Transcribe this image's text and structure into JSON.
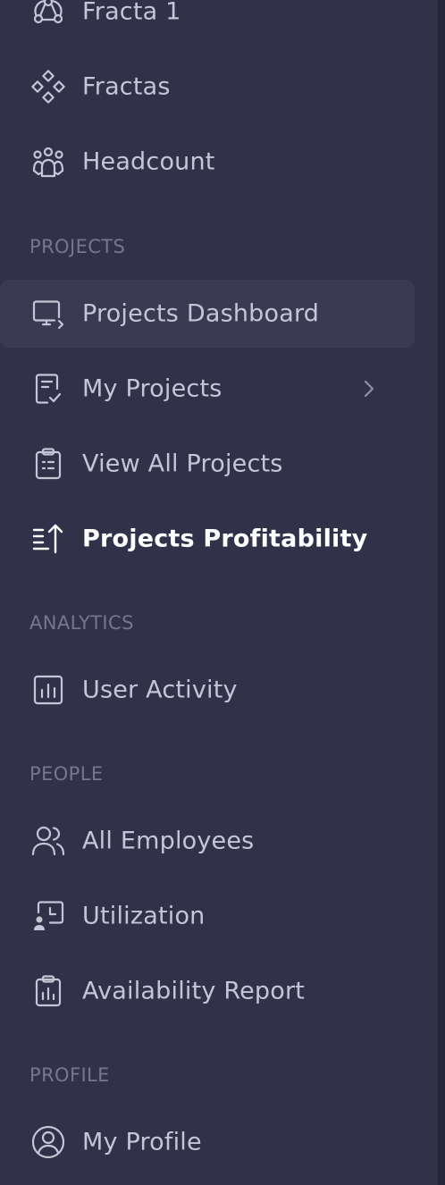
{
  "nav": {
    "top_items": [
      {
        "label": "Fracta 1",
        "icon": "fracta-network-icon"
      },
      {
        "label": "Fractas",
        "icon": "fractas-diamond-icon"
      },
      {
        "label": "Headcount",
        "icon": "headcount-people-icon"
      }
    ],
    "sections": {
      "projects": "PROJECTS",
      "analytics": "ANALYTICS",
      "people": "PEOPLE",
      "profile": "PROFILE"
    },
    "projects_items": [
      {
        "label": "Projects Dashboard",
        "icon": "monitor-icon"
      },
      {
        "label": "My Projects",
        "icon": "document-check-icon"
      },
      {
        "label": "View All Projects",
        "icon": "clipboard-list-icon"
      },
      {
        "label": "Projects Profitability",
        "icon": "sort-arrow-up-icon"
      }
    ],
    "analytics_items": [
      {
        "label": "User Activity",
        "icon": "bar-chart-icon"
      }
    ],
    "people_items": [
      {
        "label": "All Employees",
        "icon": "users-icon"
      },
      {
        "label": "Utilization",
        "icon": "utilization-icon"
      },
      {
        "label": "Availability Report",
        "icon": "clipboard-chart-icon"
      }
    ],
    "profile_items": [
      {
        "label": "My Profile",
        "icon": "user-circle-icon"
      }
    ]
  },
  "colors": {
    "background": "#313249",
    "active_item_bg": "#3a3b53",
    "text": "#c4c5d6",
    "text_active": "#ffffff",
    "section_text": "#75778f",
    "icon": "#c4c5d6"
  }
}
